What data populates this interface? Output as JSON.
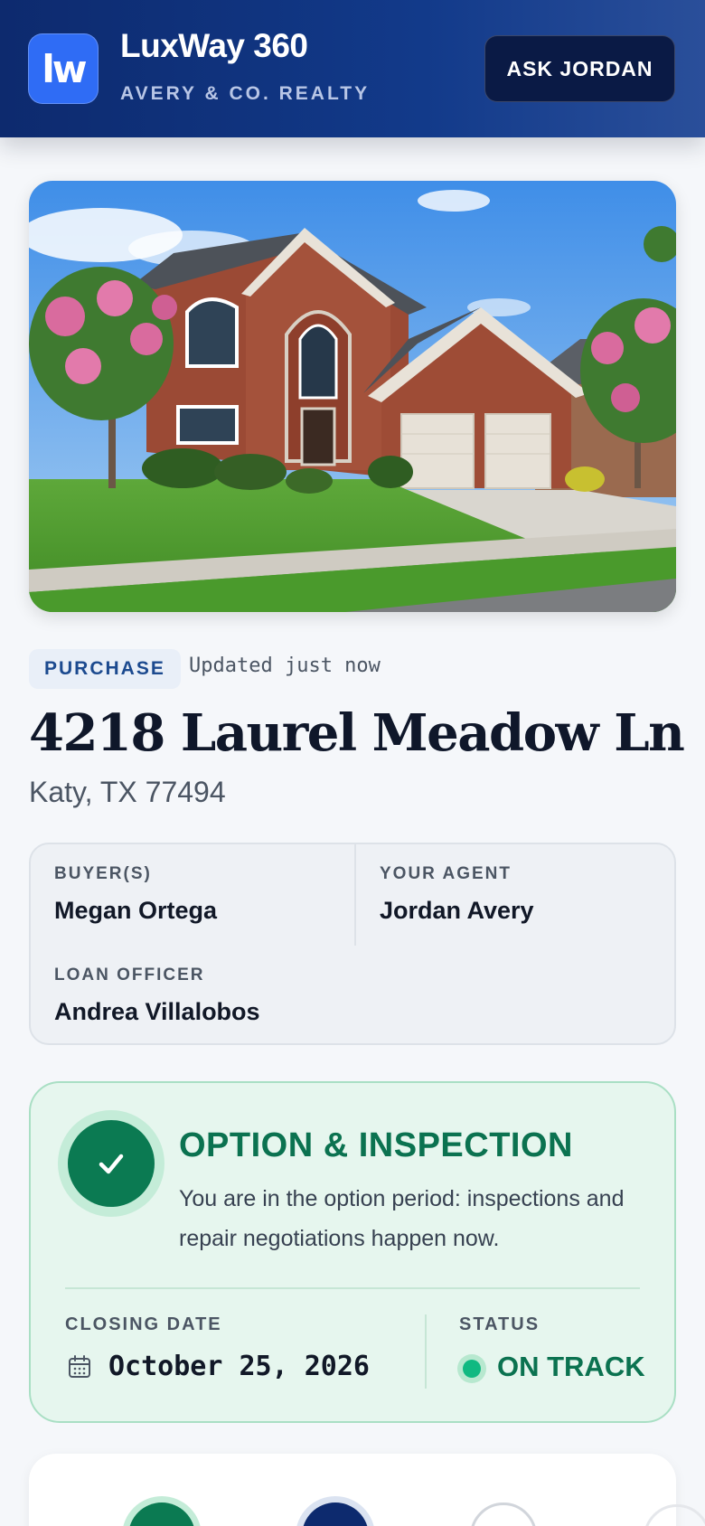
{
  "header": {
    "logo_text": "lw",
    "app_name": "LuxWay 360",
    "company": "AVERY & CO. REALTY",
    "ask_button": "ASK JORDAN"
  },
  "listing": {
    "transaction_type": "PURCHASE",
    "updated": "Updated just now",
    "address": "4218 Laurel Meadow Ln",
    "city": "Katy, TX 77494"
  },
  "people": {
    "buyer_label": "BUYER(S)",
    "buyer": "Megan Ortega",
    "agent_label": "YOUR AGENT",
    "agent": "Jordan Avery",
    "loan_label": "LOAN OFFICER",
    "loan_officer": "Andrea Villalobos"
  },
  "phase": {
    "title": "OPTION & INSPECTION",
    "description": "You are in the option period: inspections and repair negotiations happen now.",
    "closing_label": "CLOSING DATE",
    "closing_date": "October 25, 2026",
    "status_label": "STATUS",
    "status": "ON TRACK"
  },
  "icons": {
    "check": "check-icon",
    "calendar": "calendar-icon",
    "status_dot": "status-dot-icon"
  },
  "colors": {
    "header": "#0d2a6e",
    "accent_green": "#0b7250",
    "status_green": "#10b981"
  }
}
